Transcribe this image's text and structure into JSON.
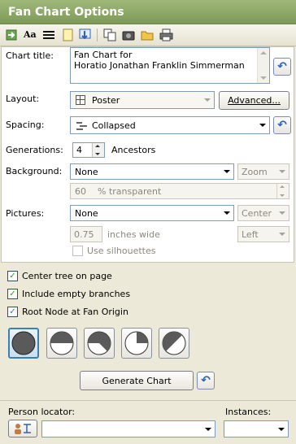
{
  "window": {
    "title": "Fan Chart Options"
  },
  "toolbar": {
    "icons": [
      "import-icon",
      "font-icon",
      "lines-icon",
      "page-icon",
      "download-icon",
      "copy-icon",
      "camera-icon",
      "folder-icon",
      "print-icon"
    ]
  },
  "chart_title": {
    "label": "Chart title:",
    "line1": "Fan Chart for",
    "line2": "Horatio Jonathan Franklin Simmerman"
  },
  "layout": {
    "label": "Layout:",
    "value": "Poster",
    "advanced": "Advanced..."
  },
  "spacing": {
    "label": "Spacing:",
    "value": "Collapsed"
  },
  "generations": {
    "label": "Generations:",
    "value": "4",
    "unit": "Ancestors"
  },
  "background": {
    "label": "Background:",
    "value": "None",
    "mode": "Zoom",
    "transparency": "60",
    "transparency_unit": "% transparent"
  },
  "pictures": {
    "label": "Pictures:",
    "value": "None",
    "position": "Center",
    "width": "0.75",
    "width_unit": "inches wide",
    "align": "Left",
    "silhouettes": "Use silhouettes"
  },
  "options": [
    {
      "label": "Center tree on page",
      "checked": true
    },
    {
      "label": "Include empty branches",
      "checked": true
    },
    {
      "label": "Root Node at Fan Origin",
      "checked": true
    }
  ],
  "generate": {
    "label": "Generate Chart"
  },
  "person_locator": {
    "label": "Person locator:",
    "value": ""
  },
  "instances": {
    "label": "Instances:",
    "value": ""
  },
  "colors": {
    "title_bar": "#8aa763",
    "accent": "#3c7fb1"
  }
}
